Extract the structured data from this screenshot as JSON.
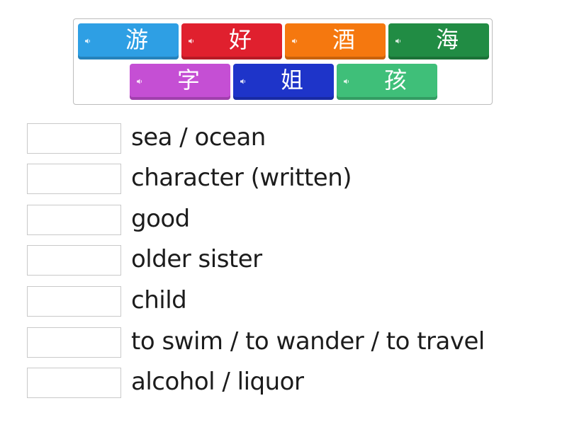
{
  "tiles": [
    {
      "char": "游",
      "color": "#2e9fe4",
      "icon": "speaker-icon"
    },
    {
      "char": "好",
      "color": "#e0202e",
      "icon": "speaker-icon"
    },
    {
      "char": "酒",
      "color": "#f5780f",
      "icon": "speaker-icon"
    },
    {
      "char": "海",
      "color": "#218c44",
      "icon": "speaker-icon"
    },
    {
      "char": "字",
      "color": "#c54fd4",
      "icon": "speaker-icon"
    },
    {
      "char": "姐",
      "color": "#1e34c9",
      "icon": "speaker-icon"
    },
    {
      "char": "孩",
      "color": "#3fbf79",
      "icon": "speaker-icon"
    }
  ],
  "definitions": [
    {
      "text": "sea / ocean"
    },
    {
      "text": "character (written)"
    },
    {
      "text": "good"
    },
    {
      "text": "older sister"
    },
    {
      "text": "child"
    },
    {
      "text": "to swim / to wander / to travel"
    },
    {
      "text": "alcohol / liquor"
    }
  ]
}
